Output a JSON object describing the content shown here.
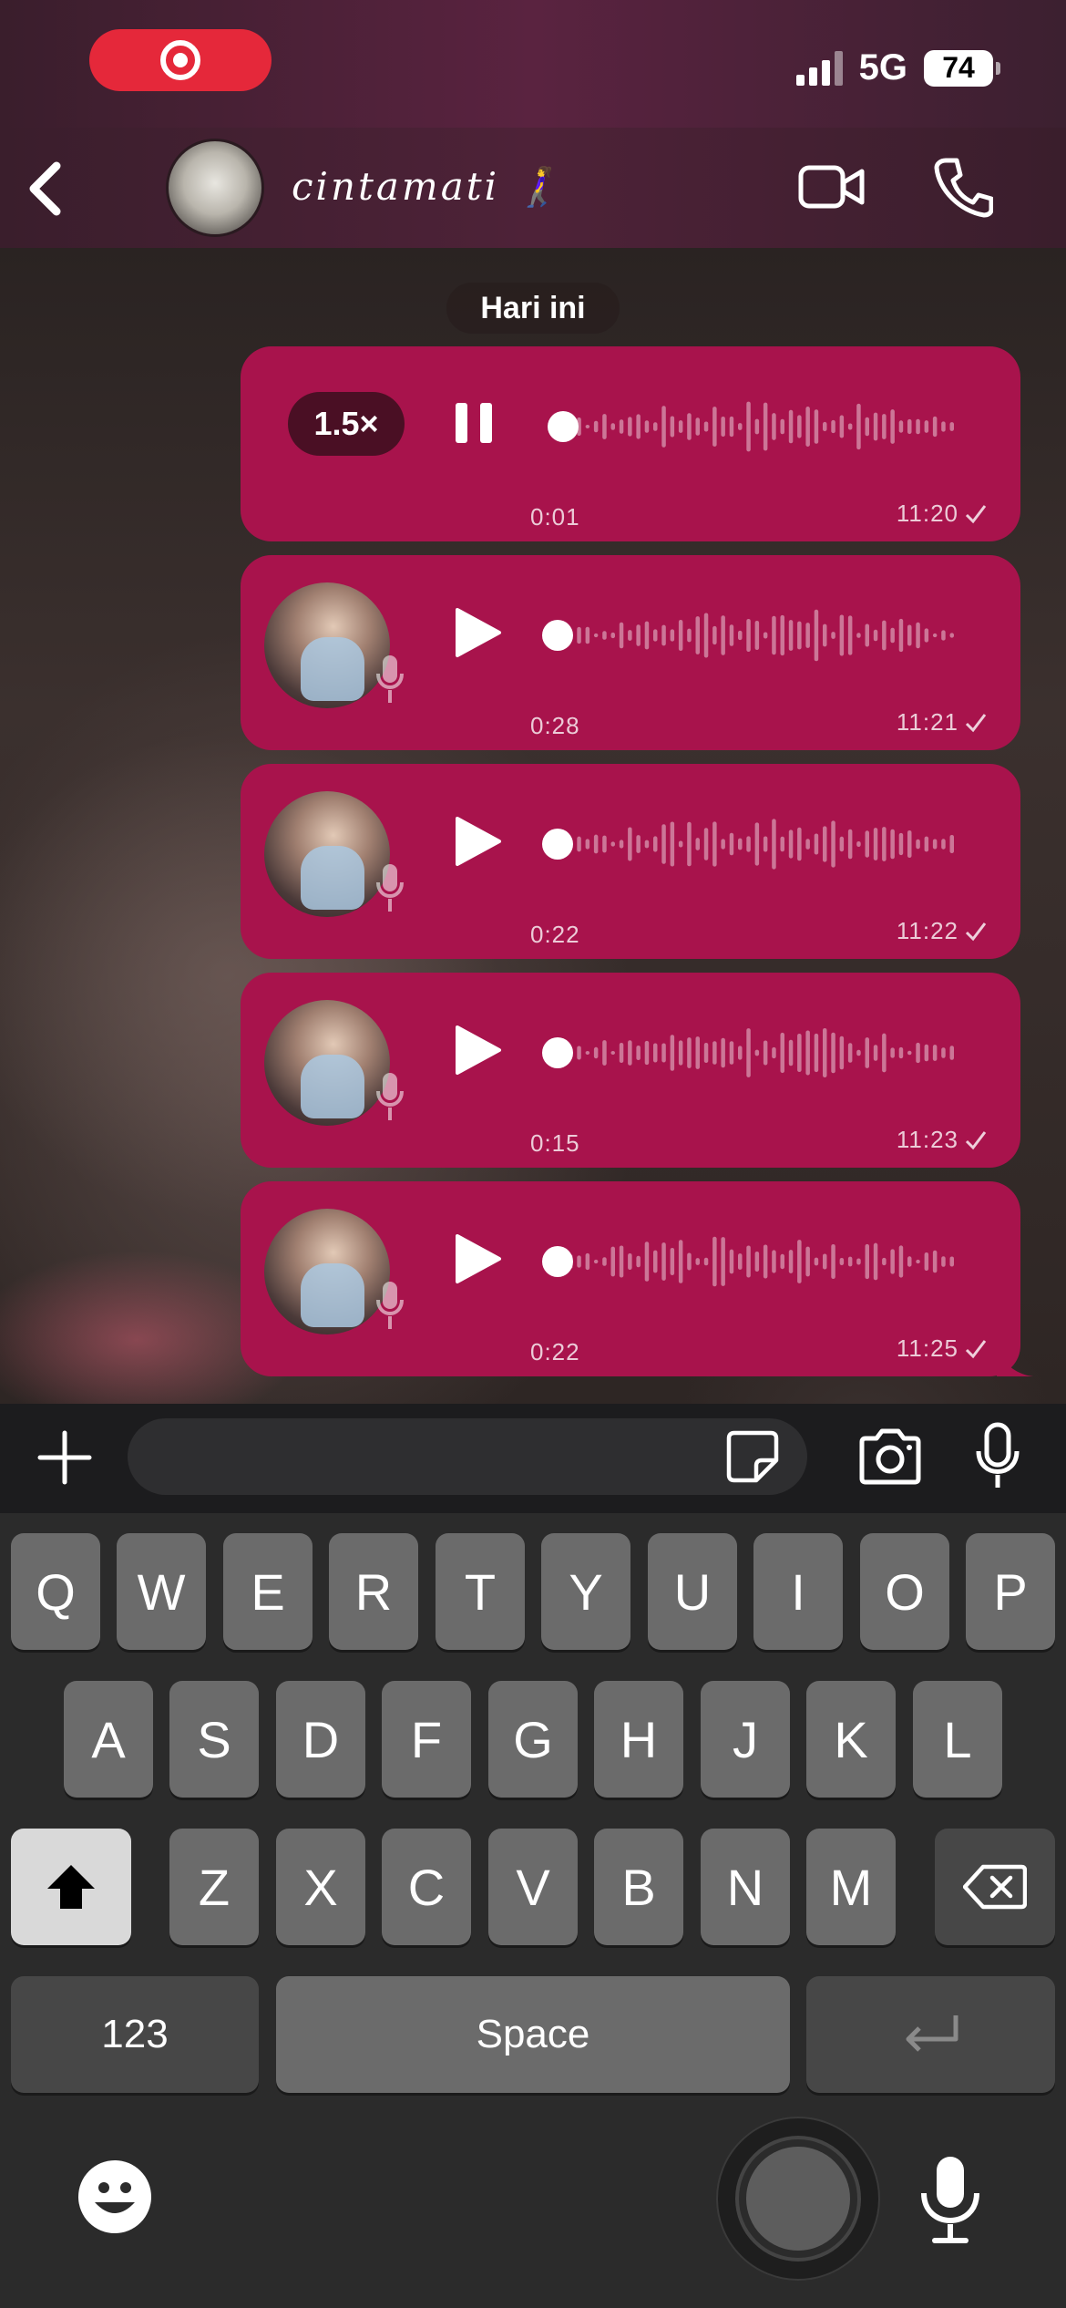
{
  "status_bar": {
    "network": "5G",
    "battery": "74"
  },
  "header": {
    "contact_name": "cintamati 🚶‍♀️"
  },
  "chat": {
    "date_label": "Hari ini",
    "messages": [
      {
        "type": "voice",
        "playing": true,
        "speed": "1.5×",
        "duration": "0:01",
        "time": "11:20"
      },
      {
        "type": "voice",
        "playing": false,
        "duration": "0:28",
        "time": "11:21"
      },
      {
        "type": "voice",
        "playing": false,
        "duration": "0:22",
        "time": "11:22"
      },
      {
        "type": "voice",
        "playing": false,
        "duration": "0:15",
        "time": "11:23"
      },
      {
        "type": "voice",
        "playing": false,
        "duration": "0:22",
        "time": "11:25"
      }
    ]
  },
  "composer": {
    "input_value": "",
    "input_placeholder": ""
  },
  "keyboard": {
    "row1": [
      "Q",
      "W",
      "E",
      "R",
      "T",
      "Y",
      "U",
      "I",
      "O",
      "P"
    ],
    "row2": [
      "A",
      "S",
      "D",
      "F",
      "G",
      "H",
      "J",
      "K",
      "L"
    ],
    "row3": [
      "Z",
      "X",
      "C",
      "V",
      "B",
      "N",
      "M"
    ],
    "numbers_label": "123",
    "space_label": "Space"
  },
  "colors": {
    "bubble": "#a8134c",
    "record_pill": "#e5283a",
    "header": "#4e2238"
  },
  "icons": [
    "record-icon",
    "signal-icon",
    "back-icon",
    "video-call-icon",
    "phone-icon",
    "pause-icon",
    "play-icon",
    "mic-icon",
    "check-icon",
    "plus-icon",
    "sticker-icon",
    "camera-icon",
    "shift-icon",
    "backspace-icon",
    "return-icon",
    "emoji-icon",
    "dictation-icon"
  ]
}
